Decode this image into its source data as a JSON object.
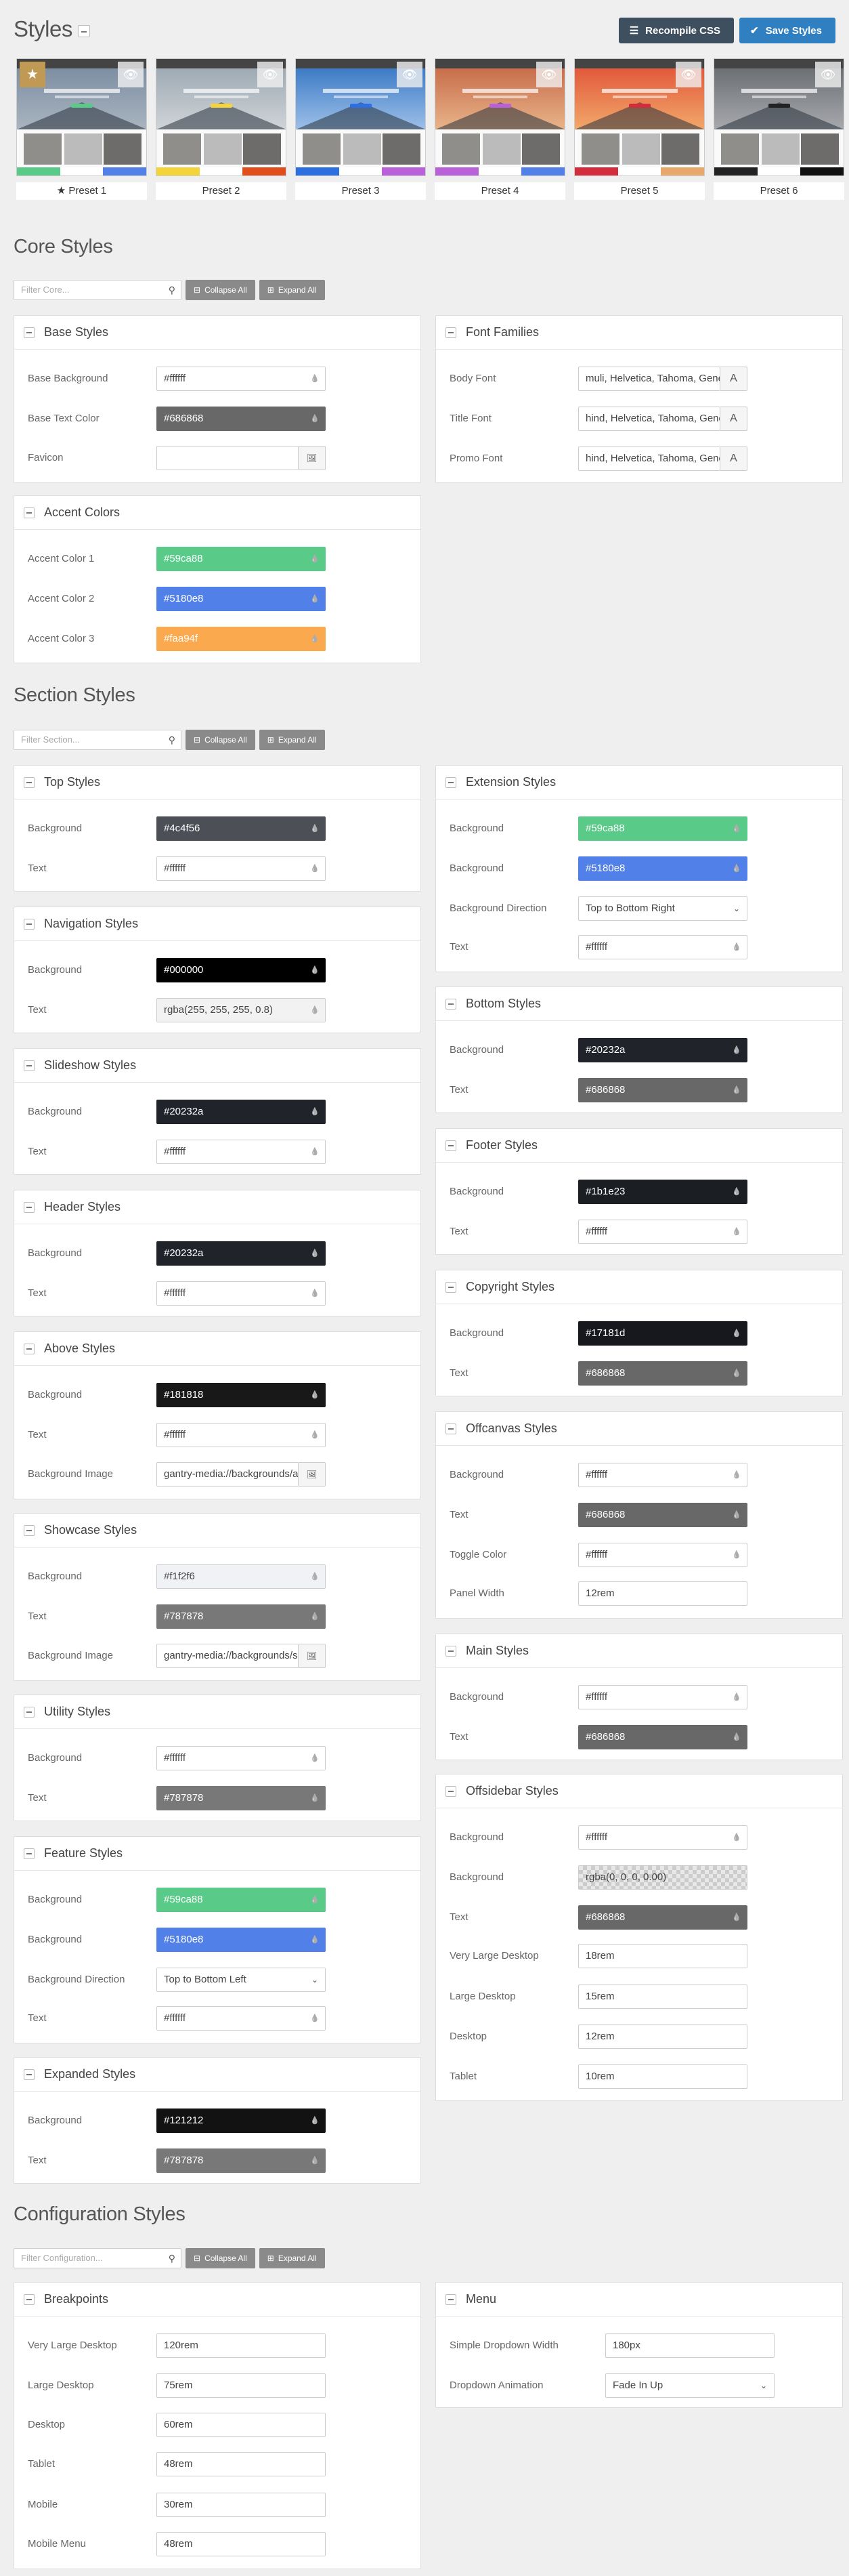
{
  "page": {
    "title": "Styles"
  },
  "toolbar": {
    "recompile_label": "Recompile CSS",
    "save_label": "Save Styles"
  },
  "presets": [
    {
      "label": "Preset 1",
      "active": true,
      "sky": [
        "#7d8fa3",
        "#a9b4bf"
      ],
      "accent": "#59ca88",
      "bars": [
        "#59ca88",
        "#ffffff",
        "#5180e8"
      ]
    },
    {
      "label": "Preset 2",
      "active": false,
      "sky": [
        "#9eaab4",
        "#cfd4d8"
      ],
      "accent": "#f4d43b",
      "bars": [
        "#f4d43b",
        "#ffffff",
        "#e04e1b"
      ]
    },
    {
      "label": "Preset 3",
      "active": false,
      "sky": [
        "#3d7bc6",
        "#9dc0e8"
      ],
      "accent": "#2d6fe0",
      "bars": [
        "#2d6fe0",
        "#ffffff",
        "#b961d8"
      ]
    },
    {
      "label": "Preset 4",
      "active": false,
      "sky": [
        "#c86e4b",
        "#e8b48a"
      ],
      "accent": "#b961d8",
      "bars": [
        "#b961d8",
        "#ffffff",
        "#5180e8"
      ]
    },
    {
      "label": "Preset 5",
      "active": false,
      "sky": [
        "#e2593b",
        "#f2a86a"
      ],
      "accent": "#d32c3c",
      "bars": [
        "#d32c3c",
        "#ffffff",
        "#e8a86b"
      ]
    },
    {
      "label": "Preset 6",
      "active": false,
      "sky": [
        "#6c6f74",
        "#a7a9ad"
      ],
      "accent": "#222222",
      "bars": [
        "#222222",
        "#ffffff",
        "#111111"
      ]
    }
  ],
  "sections": {
    "core": {
      "title": "Core Styles",
      "filter_placeholder": "Filter Core..."
    },
    "section": {
      "title": "Section Styles",
      "filter_placeholder": "Filter Section..."
    },
    "config": {
      "title": "Configuration Styles",
      "filter_placeholder": "Filter Configuration..."
    },
    "collapse_label": "Collapse All",
    "expand_label": "Expand All"
  },
  "panels": {
    "base": {
      "title": "Base Styles",
      "rows": [
        {
          "label": "Base Background",
          "value": "#ffffff",
          "color": "#ffffff",
          "dark": false
        },
        {
          "label": "Base Text Color",
          "value": "#686868",
          "color": "#686868",
          "dark": true
        },
        {
          "label": "Favicon",
          "value": ""
        }
      ]
    },
    "accent": {
      "title": "Accent Colors",
      "rows": [
        {
          "label": "Accent Color 1",
          "value": "#59ca88",
          "color": "#59ca88"
        },
        {
          "label": "Accent Color 2",
          "value": "#5180e8",
          "color": "#5180e8"
        },
        {
          "label": "Accent Color 3",
          "value": "#faa94f",
          "color": "#faa94f"
        }
      ]
    },
    "fonts": {
      "title": "Font Families",
      "rows": [
        {
          "label": "Body Font",
          "value": "muli, Helvetica, Tahoma, Geneva, Arial, sans-serif"
        },
        {
          "label": "Title Font",
          "value": "hind, Helvetica, Tahoma, Geneva, Arial, sans-serif"
        },
        {
          "label": "Promo Font",
          "value": "hind, Helvetica, Tahoma, Geneva, Arial, sans-serif"
        }
      ]
    },
    "top": {
      "title": "Top Styles",
      "rows": [
        {
          "label": "Background",
          "value": "#4c4f56",
          "color": "#4c4f56"
        },
        {
          "label": "Text",
          "value": "#ffffff",
          "color": "#ffffff"
        }
      ]
    },
    "navigation": {
      "title": "Navigation Styles",
      "rows": [
        {
          "label": "Background",
          "value": "#000000",
          "color": "#000000"
        },
        {
          "label": "Text",
          "value": "rgba(255, 255, 255, 0.8)",
          "color": "#f2f2f2"
        }
      ]
    },
    "slideshow": {
      "title": "Slideshow Styles",
      "rows": [
        {
          "label": "Background",
          "value": "#20232a",
          "color": "#20232a"
        },
        {
          "label": "Text",
          "value": "#ffffff",
          "color": "#ffffff"
        }
      ]
    },
    "header": {
      "title": "Header Styles",
      "rows": [
        {
          "label": "Background",
          "value": "#20232a",
          "color": "#20232a"
        },
        {
          "label": "Text",
          "value": "#ffffff",
          "color": "#ffffff"
        }
      ]
    },
    "above": {
      "title": "Above Styles",
      "rows": [
        {
          "label": "Background",
          "value": "#181818",
          "color": "#181818"
        },
        {
          "label": "Text",
          "value": "#ffffff",
          "color": "#ffffff"
        },
        {
          "label": "Background Image",
          "value": "gantry-media://backgrounds/above.jpg"
        }
      ]
    },
    "showcase": {
      "title": "Showcase Styles",
      "rows": [
        {
          "label": "Background",
          "value": "#f1f2f6",
          "color": "#f1f2f6"
        },
        {
          "label": "Text",
          "value": "#787878",
          "color": "#787878"
        },
        {
          "label": "Background Image",
          "value": "gantry-media://backgrounds/showcase.jpg"
        }
      ]
    },
    "utility": {
      "title": "Utility Styles",
      "rows": [
        {
          "label": "Background",
          "value": "#ffffff",
          "color": "#ffffff"
        },
        {
          "label": "Text",
          "value": "#787878",
          "color": "#787878"
        }
      ]
    },
    "feature": {
      "title": "Feature Styles",
      "rows": [
        {
          "label": "Background",
          "value": "#59ca88",
          "color": "#59ca88"
        },
        {
          "label": "Background",
          "value": "#5180e8",
          "color": "#5180e8"
        },
        {
          "label": "Background Direction",
          "value": "Top to Bottom Left"
        },
        {
          "label": "Text",
          "value": "#ffffff",
          "color": "#ffffff"
        }
      ]
    },
    "expanded": {
      "title": "Expanded Styles",
      "rows": [
        {
          "label": "Background",
          "value": "#121212",
          "color": "#121212"
        },
        {
          "label": "Text",
          "value": "#787878",
          "color": "#787878"
        }
      ]
    },
    "extension": {
      "title": "Extension Styles",
      "rows": [
        {
          "label": "Background",
          "value": "#59ca88",
          "color": "#59ca88"
        },
        {
          "label": "Background",
          "value": "#5180e8",
          "color": "#5180e8"
        },
        {
          "label": "Background Direction",
          "value": "Top to Bottom Right"
        },
        {
          "label": "Text",
          "value": "#ffffff",
          "color": "#ffffff"
        }
      ]
    },
    "bottom": {
      "title": "Bottom Styles",
      "rows": [
        {
          "label": "Background",
          "value": "#20232a",
          "color": "#20232a"
        },
        {
          "label": "Text",
          "value": "#686868",
          "color": "#686868"
        }
      ]
    },
    "footer": {
      "title": "Footer Styles",
      "rows": [
        {
          "label": "Background",
          "value": "#1b1e23",
          "color": "#1b1e23"
        },
        {
          "label": "Text",
          "value": "#ffffff",
          "color": "#ffffff"
        }
      ]
    },
    "copyright": {
      "title": "Copyright Styles",
      "rows": [
        {
          "label": "Background",
          "value": "#17181d",
          "color": "#17181d"
        },
        {
          "label": "Text",
          "value": "#686868",
          "color": "#686868"
        }
      ]
    },
    "offcanvas": {
      "title": "Offcanvas Styles",
      "rows": [
        {
          "label": "Background",
          "value": "#ffffff",
          "color": "#ffffff"
        },
        {
          "label": "Text",
          "value": "#686868",
          "color": "#686868"
        },
        {
          "label": "Toggle Color",
          "value": "#ffffff",
          "color": "#ffffff"
        },
        {
          "label": "Panel Width",
          "value": "12rem"
        }
      ]
    },
    "main": {
      "title": "Main Styles",
      "rows": [
        {
          "label": "Background",
          "value": "#ffffff",
          "color": "#ffffff"
        },
        {
          "label": "Text",
          "value": "#686868",
          "color": "#686868"
        }
      ]
    },
    "offsidebar": {
      "title": "Offsidebar Styles",
      "rows": [
        {
          "label": "Background",
          "value": "#ffffff",
          "color": "#ffffff"
        },
        {
          "label": "Background",
          "value": "rgba(0, 0, 0, 0.00)",
          "color": "checker"
        },
        {
          "label": "Text",
          "value": "#686868",
          "color": "#686868"
        },
        {
          "label": "Very Large Desktop",
          "value": "18rem"
        },
        {
          "label": "Large Desktop",
          "value": "15rem"
        },
        {
          "label": "Desktop",
          "value": "12rem"
        },
        {
          "label": "Tablet",
          "value": "10rem"
        }
      ]
    },
    "breakpoints": {
      "title": "Breakpoints",
      "rows": [
        {
          "label": "Very Large Desktop",
          "value": "120rem"
        },
        {
          "label": "Large Desktop",
          "value": "75rem"
        },
        {
          "label": "Desktop",
          "value": "60rem"
        },
        {
          "label": "Tablet",
          "value": "48rem"
        },
        {
          "label": "Mobile",
          "value": "30rem"
        },
        {
          "label": "Mobile Menu",
          "value": "48rem"
        }
      ]
    },
    "menu": {
      "title": "Menu",
      "rows": [
        {
          "label": "Simple Dropdown Width",
          "value": "180px"
        },
        {
          "label": "Dropdown Animation",
          "value": "Fade In Up"
        }
      ]
    }
  }
}
